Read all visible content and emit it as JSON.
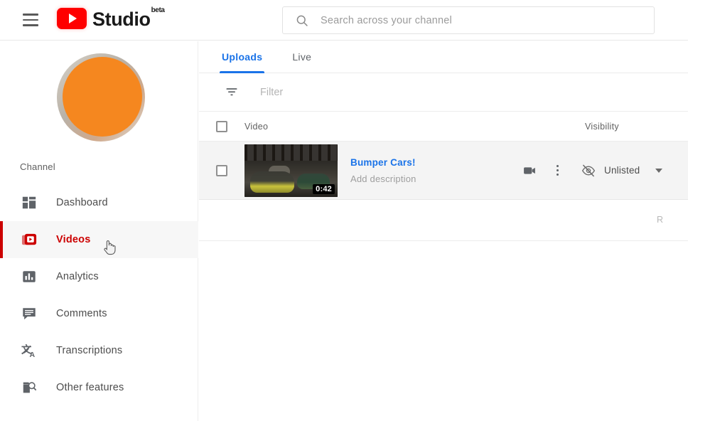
{
  "header": {
    "menu_icon": "hamburger-menu-icon",
    "brand_name": "Studio",
    "brand_superscript": "beta",
    "logo_icon": "youtube-logo-icon",
    "search": {
      "icon": "search-icon",
      "placeholder": "Search across your channel",
      "value": ""
    }
  },
  "sidebar": {
    "avatar": "channel-avatar",
    "section_label": "Channel",
    "items": [
      {
        "label": "Dashboard",
        "icon": "dashboard-grid-icon",
        "active": false
      },
      {
        "label": "Videos",
        "icon": "videos-stack-icon",
        "active": true
      },
      {
        "label": "Analytics",
        "icon": "analytics-bar-icon",
        "active": false
      },
      {
        "label": "Comments",
        "icon": "comment-bubble-icon",
        "active": false
      },
      {
        "label": "Transcriptions",
        "icon": "translate-icon",
        "active": false
      },
      {
        "label": "Other features",
        "icon": "other-features-icon",
        "active": false
      }
    ]
  },
  "main": {
    "tabs": [
      {
        "label": "Uploads",
        "active": true
      },
      {
        "label": "Live",
        "active": false
      }
    ],
    "filter": {
      "icon": "filter-funnel-icon",
      "placeholder": "Filter",
      "value": ""
    },
    "table": {
      "columns": {
        "video": "Video",
        "visibility": "Visibility"
      },
      "rows": [
        {
          "checked": false,
          "title": "Bumper Cars!",
          "description": "Add description",
          "duration": "0:42",
          "visibility": "Unlisted",
          "visibility_icon": "eye-off-icon",
          "video_icon": "video-camera-icon",
          "menu_icon": "kebab-menu-icon",
          "caret_icon": "chevron-down-icon"
        }
      ],
      "footer_text": "R"
    }
  },
  "colors": {
    "brand_red": "#cc0000",
    "accent_blue": "#1a73e8",
    "avatar_orange": "#f5871f",
    "row_highlight": "#f4f4f4"
  },
  "cursor": {
    "icon": "pointer-hand-cursor"
  }
}
